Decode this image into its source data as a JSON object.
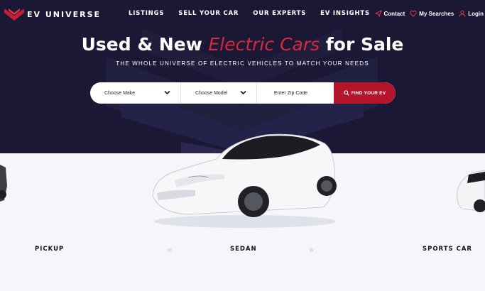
{
  "brand": {
    "name": "EV UNIVERSE",
    "accent_color": "#d4293f",
    "background_color": "#1b1836"
  },
  "nav": {
    "links": [
      "LISTINGS",
      "SELL YOUR CAR",
      "OUR EXPERTS",
      "EV INSIGHTS"
    ],
    "utility": [
      {
        "label": "Contact",
        "icon": "send-icon"
      },
      {
        "label": "My Searches",
        "icon": "heart-icon"
      },
      {
        "label": "Login",
        "icon": "user-icon"
      }
    ]
  },
  "hero": {
    "headline_prefix": "Used & New",
    "headline_accent": "Electric Cars",
    "headline_suffix": "for Sale",
    "subheadline": "THE WHOLE UNIVERSE OF ELECTRIC VEHICLES TO MATCH YOUR NEEDS"
  },
  "search": {
    "make_label": "Choose Make",
    "model_label": "Choose Model",
    "zip_placeholder": "Enter Zip Code",
    "button_label": "FIND YOUR EV",
    "button_color": "#b3162b"
  },
  "carousel": {
    "categories": [
      "PICKUP",
      "SEDAN",
      "SPORTS CAR"
    ],
    "prev_symbol": "«",
    "next_symbol": "»"
  }
}
